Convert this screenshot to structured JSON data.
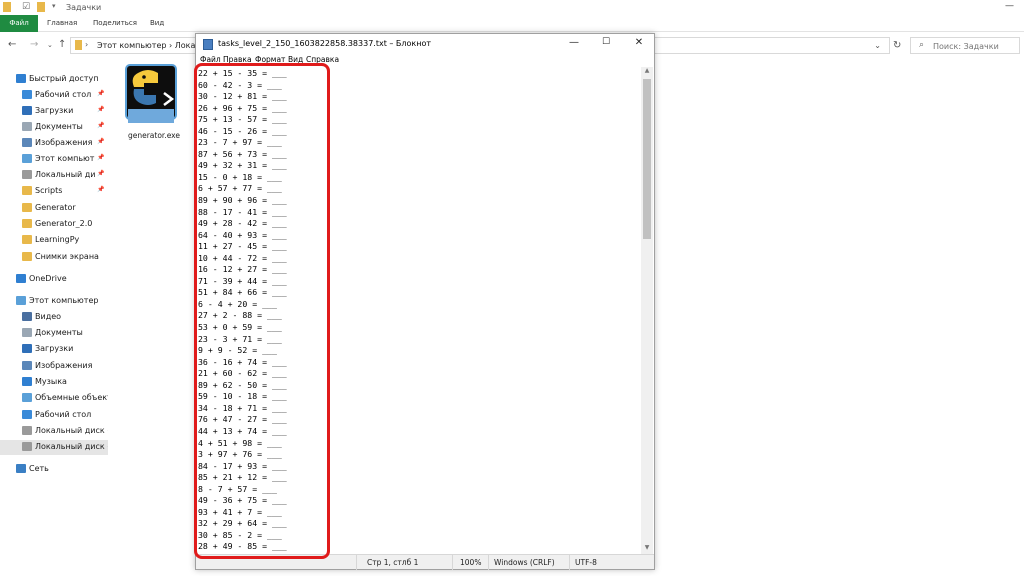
{
  "explorer": {
    "title": "Задачки",
    "ribbon_tabs": [
      "Файл",
      "Главная",
      "Поделиться",
      "Вид"
    ],
    "breadcrumb": "Этот компьютер  ›  Локаль",
    "search_placeholder": "Поиск: Задачки"
  },
  "sidebar": {
    "items": [
      {
        "label": "Быстрый доступ",
        "icon": "star-icon",
        "color": "#2f7fd1",
        "pinned": false
      },
      {
        "label": "Рабочий стол",
        "icon": "desktop-icon",
        "color": "#3a8ad8",
        "pinned": true
      },
      {
        "label": "Загрузки",
        "icon": "download-icon",
        "color": "#2f6fb8",
        "pinned": true
      },
      {
        "label": "Документы",
        "icon": "document-icon",
        "color": "#9aa7b4",
        "pinned": true
      },
      {
        "label": "Изображения",
        "icon": "image-icon",
        "color": "#5b87b9",
        "pinned": true
      },
      {
        "label": "Этот компьютер",
        "icon": "computer-icon",
        "color": "#5aa0d8",
        "pinned": true
      },
      {
        "label": "Локальный диск",
        "icon": "drive-icon",
        "color": "#9a9a9a",
        "pinned": true
      },
      {
        "label": "Scripts",
        "icon": "folder-icon",
        "color": "#e8b84a",
        "pinned": true
      },
      {
        "label": "Generator",
        "icon": "folder-icon",
        "color": "#e8b84a",
        "pinned": false
      },
      {
        "label": "Generator_2.0",
        "icon": "folder-icon",
        "color": "#e8b84a",
        "pinned": false
      },
      {
        "label": "LearningPy",
        "icon": "folder-icon",
        "color": "#e8b84a",
        "pinned": false
      },
      {
        "label": "Снимки экрана",
        "icon": "folder-icon",
        "color": "#e8b84a",
        "pinned": false
      },
      {
        "label": "OneDrive",
        "icon": "cloud-icon",
        "color": "#2f7fd1",
        "pinned": false
      },
      {
        "label": "Этот компьютер",
        "icon": "computer-icon",
        "color": "#5aa0d8",
        "pinned": false
      },
      {
        "label": "Видео",
        "icon": "video-icon",
        "color": "#4a6fa0",
        "pinned": false
      },
      {
        "label": "Документы",
        "icon": "document-icon",
        "color": "#9aa7b4",
        "pinned": false
      },
      {
        "label": "Загрузки",
        "icon": "download-icon",
        "color": "#2f6fb8",
        "pinned": false
      },
      {
        "label": "Изображения",
        "icon": "image-icon",
        "color": "#5b87b9",
        "pinned": false
      },
      {
        "label": "Музыка",
        "icon": "music-icon",
        "color": "#2f7fd1",
        "pinned": false
      },
      {
        "label": "Объемные объекты",
        "icon": "cube-icon",
        "color": "#5aa0d8",
        "pinned": false
      },
      {
        "label": "Рабочий стол",
        "icon": "desktop-icon",
        "color": "#3a8ad8",
        "pinned": false
      },
      {
        "label": "Локальный диск (C",
        "icon": "drive-icon",
        "color": "#9a9a9a",
        "pinned": false
      },
      {
        "label": "Локальный диск (D",
        "icon": "drive-icon",
        "color": "#9a9a9a",
        "pinned": false,
        "selected": true
      },
      {
        "label": "Сеть",
        "icon": "network-icon",
        "color": "#3a7fc4",
        "pinned": false
      }
    ]
  },
  "file": {
    "label": "generator.exe"
  },
  "notepad": {
    "title": "tasks_level_2_150_1603822858.38337.txt – Блокнот",
    "menu": [
      "Файл",
      "Правка",
      "Формат",
      "Вид",
      "Справка"
    ],
    "lines": [
      "22 + 15 - 35 = ___",
      "60 - 42 - 3 = ___",
      "30 - 12 + 81 = ___",
      "26 + 96 + 75 = ___",
      "75 + 13 - 57 = ___",
      "46 - 15 - 26 = ___",
      "23 - 7 + 97 = ___",
      "87 + 56 + 73 = ___",
      "49 + 32 + 31 = ___",
      "15 - 0 + 18 = ___",
      "6 + 57 + 77 = ___",
      "89 + 90 + 96 = ___",
      "88 - 17 - 41 = ___",
      "49 + 28 - 42 = ___",
      "64 - 40 + 93 = ___",
      "11 + 27 - 45 = ___",
      "10 + 44 - 72 = ___",
      "16 - 12 + 27 = ___",
      "71 - 39 + 44 = ___",
      "51 + 84 + 66 = ___",
      "6 - 4 + 20 = ___",
      "27 + 2 - 88 = ___",
      "53 + 0 + 59 = ___",
      "23 - 3 + 71 = ___",
      "9 + 9 - 52 = ___",
      "36 - 16 + 74 = ___",
      "21 + 60 - 62 = ___",
      "89 + 62 - 50 = ___",
      "59 - 10 - 18 = ___",
      "34 - 18 + 71 = ___",
      "76 + 47 - 27 = ___",
      "44 + 13 + 74 = ___",
      "4 + 51 + 98 = ___",
      "3 + 97 + 76 = ___",
      "84 - 17 + 93 = ___",
      "85 + 21 + 12 = ___",
      "8 - 7 + 57 = ___",
      "49 - 36 + 75 = ___",
      "93 + 41 + 7 = ___",
      "32 + 29 + 64 = ___",
      "30 + 85 - 2 = ___",
      "28 + 49 - 85 = ___"
    ],
    "status": {
      "position": "Стр 1, стлб 1",
      "zoom": "100%",
      "line_endings": "Windows (CRLF)",
      "encoding": "UTF-8"
    }
  },
  "colors": {
    "accent_green": "#1f8b41",
    "highlight_red": "#e01b1b"
  }
}
